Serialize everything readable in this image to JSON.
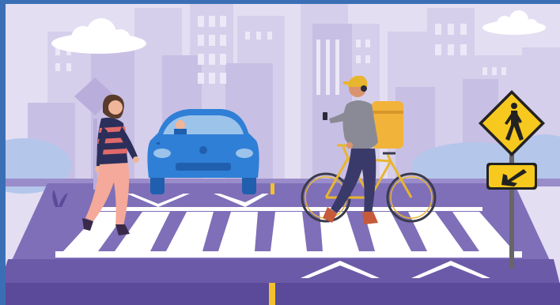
{
  "scene": {
    "frame": {
      "top_bar_color": "#3a6fb5",
      "left_bar_color": "#3a6fb5"
    },
    "colors": {
      "sky": "#e3def2",
      "building_far": "#d6cfeb",
      "building_mid": "#c8bfe4",
      "building_near": "#b9aedb",
      "window": "#ece8f7",
      "cloud": "#ffffff",
      "bush": "#b4c6ea",
      "road": "#7f6fb8",
      "road_dark": "#6b5aa8",
      "crosswalk": "#ffffff",
      "curb": "#5a4a99",
      "sidewalk": "#9a8cca",
      "yellow_line": "#f2c12e",
      "car_body": "#2f7fd6",
      "car_dark": "#1f5fae",
      "car_glass": "#9cc3ea",
      "sign_yellow": "#f7c81e",
      "sign_border": "#222222",
      "pole": "#666666",
      "bicycle_frame": "#e8b52f",
      "backpack": "#f2b33a"
    },
    "elements": [
      "city-skyline",
      "clouds",
      "pedestrian-woman",
      "blue-car",
      "delivery-man-with-bicycle",
      "pedestrian-crossing-sign",
      "arrow-sign",
      "zebra-crosswalk"
    ]
  }
}
